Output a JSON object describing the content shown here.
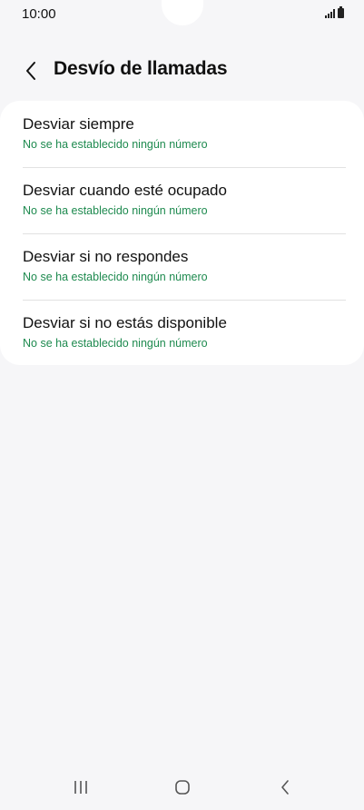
{
  "status_bar": {
    "time": "10:00"
  },
  "header": {
    "title": "Desvío de llamadas",
    "back_icon": "chevron-left-icon"
  },
  "list": {
    "items": [
      {
        "title": "Desviar siempre",
        "subtitle": "No se ha establecido ningún número"
      },
      {
        "title": "Desviar cuando esté ocupado",
        "subtitle": "No se ha establecido ningún número"
      },
      {
        "title": "Desviar si no respondes",
        "subtitle": "No se ha establecido ningún número"
      },
      {
        "title": "Desviar si no estás disponible",
        "subtitle": "No se ha establecido ningún número"
      }
    ]
  },
  "nav_bar": {
    "recents_icon": "recents-icon",
    "home_icon": "home-icon",
    "back_icon": "back-icon"
  },
  "colors": {
    "background": "#f6f6f8",
    "card": "#ffffff",
    "subtitle": "#1e8a4f",
    "text": "#111111"
  }
}
